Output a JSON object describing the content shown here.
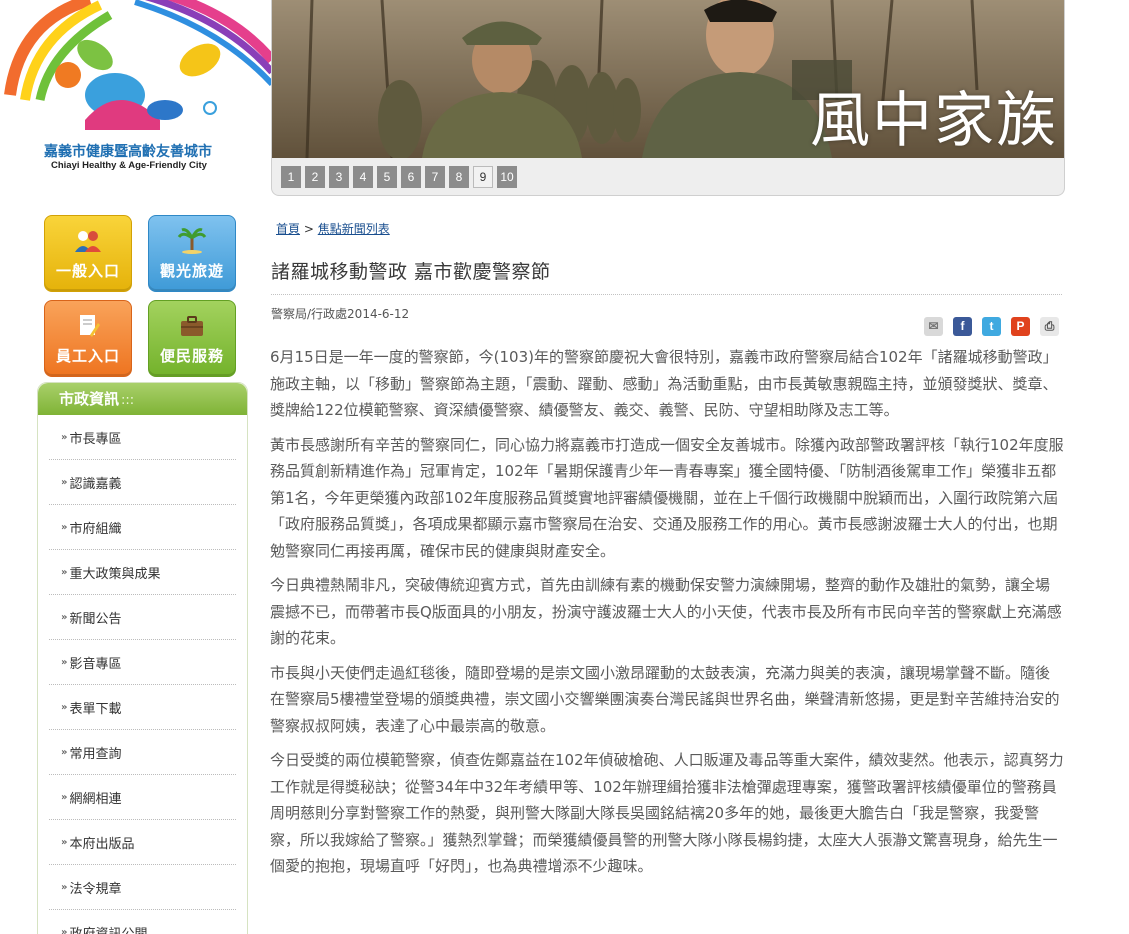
{
  "logo": {
    "caption_zh": "嘉義市健康暨高齡友善城市",
    "caption_en": "Chiayi Healthy & Age-Friendly City"
  },
  "banner": {
    "title": "風中家族",
    "pages": [
      "1",
      "2",
      "3",
      "4",
      "5",
      "6",
      "7",
      "8",
      "9",
      "10"
    ],
    "active_page": "9"
  },
  "quick_links": {
    "general": "一般入口",
    "tourism": "觀光旅遊",
    "employee": "員工入口",
    "service": "便民服務"
  },
  "sidebar": {
    "header": "市政資訊",
    "header_dots": ":::",
    "items": [
      {
        "label": "市長專區"
      },
      {
        "label": "認識嘉義"
      },
      {
        "label": "市府組織"
      },
      {
        "label": "重大政策與成果"
      },
      {
        "label": "新聞公告"
      },
      {
        "label": "影音專區"
      },
      {
        "label": "表單下載"
      },
      {
        "label": "常用查詢"
      },
      {
        "label": "網網相連"
      },
      {
        "label": "本府出版品"
      },
      {
        "label": "法令規章"
      },
      {
        "label": "政府資訊公開"
      }
    ]
  },
  "breadcrumb": {
    "home": "首頁",
    "sep": ">",
    "list": "焦點新聞列表"
  },
  "article": {
    "title": "諸羅城移動警政 嘉市歡慶警察節",
    "meta": "警察局/行政處2014-6-12",
    "paragraphs": [
      "6月15日是一年一度的警察節，今(103)年的警察節慶祝大會很特別，嘉義市政府警察局結合102年「諸羅城移動警政」施政主軸，以「移動」警察節為主題，「震動、躍動、感動」為活動重點，由市長黃敏惠親臨主持，並頒發獎狀、獎章、獎牌給122位模範警察、資深績優警察、績優警友、義交、義警、民防、守望相助隊及志工等。",
      "黃市長感謝所有辛苦的警察同仁，同心協力將嘉義市打造成一個安全友善城市。除獲內政部警政署評核「執行102年度服務品質創新精進作為」冠軍肯定，102年「暑期保護青少年一青春專案」獲全國特優、「防制酒後駕車工作」榮獲非五都第1名，今年更榮獲內政部102年度服務品質獎實地評審績優機關，並在上千個行政機關中脫穎而出，入圍行政院第六屆「政府服務品質獎」，各項成果都顯示嘉市警察局在治安、交通及服務工作的用心。黃市長感謝波羅士大人的付出，也期勉警察同仁再接再厲，確保市民的健康與財產安全。",
      "今日典禮熱鬧非凡，突破傳統迎賓方式，首先由訓練有素的機動保安警力演練開場，整齊的動作及雄壯的氣勢，讓全場震撼不已，而帶著市長Q版面具的小朋友，扮演守護波羅士大人的小天使，代表市長及所有市民向辛苦的警察獻上充滿感謝的花束。",
      "市長與小天使們走過紅毯後，隨即登場的是崇文國小激昂躍動的太鼓表演，充滿力與美的表演，讓現場掌聲不斷。隨後在警察局5樓禮堂登場的頒獎典禮，崇文國小交響樂團演奏台灣民謠與世界名曲，樂聲清新悠揚，更是對辛苦維持治安的警察叔叔阿姨，表達了心中最崇高的敬意。",
      "今日受獎的兩位模範警察，偵查佐鄭嘉益在102年偵破槍砲、人口販運及毒品等重大案件，績效斐然。他表示，認真努力工作就是得獎秘訣；從警34年中32年考績甲等、102年辦理緝拾獲非法槍彈處理專案，獲警政署評核績優單位的警務員周明慈則分享對警察工作的熱愛，與刑警大隊副大隊長吳國銘結褵20多年的她，最後更大膽告白「我是警察，我愛警察，所以我嫁給了警察。」獲熱烈掌聲；而榮獲績優員警的刑警大隊小隊長楊鈞捷，太座大人張瀞文驚喜現身，給先生一個愛的抱抱，現場直呼「好閃」，也為典禮增添不少趣味。"
    ]
  },
  "share": {
    "email": "✉",
    "facebook": "f",
    "twitter": "t",
    "plurk": "P",
    "print": "⎙"
  },
  "colors": {
    "sidebar_green": "#8cc043",
    "link_blue": "#1a4f8f",
    "general_yellow": "#f2c21d",
    "tourism_blue": "#4aa3de",
    "employee_orange": "#f2822e",
    "service_green": "#7cba32"
  }
}
